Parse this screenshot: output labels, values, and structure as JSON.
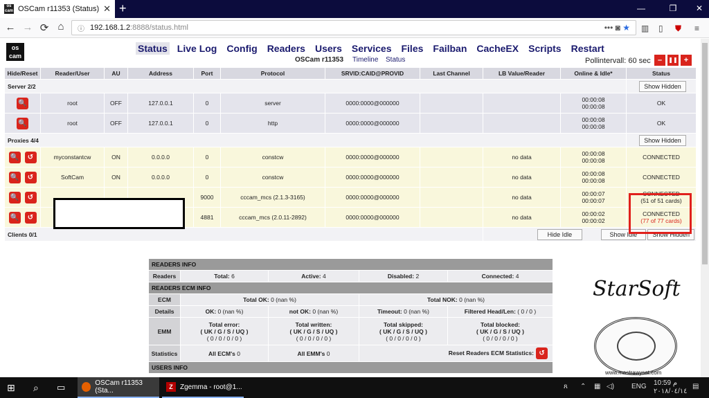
{
  "browser": {
    "tab_title": "OSCam r11353 (Status)",
    "new_tab": "+",
    "url_host": "192.168.1.2",
    "url_path": ":8888/status.html",
    "favicon": "os cam"
  },
  "nav": {
    "back": "←",
    "forward": "→",
    "reload": "⟳",
    "home": "⌂",
    "more": "•••",
    "menu": "≡"
  },
  "oscam": {
    "logo": "os cam",
    "menu": [
      "Status",
      "Live Log",
      "Config",
      "Readers",
      "Users",
      "Services",
      "Files",
      "Failban",
      "CacheEX",
      "Scripts",
      "Restart"
    ],
    "version": "OSCam r11353",
    "timeline": "Timeline",
    "status": "Status",
    "pollinterval": "Pollintervall: 60 sec",
    "btn_minus": "–",
    "btn_pause": "❚❚",
    "btn_plus": "+"
  },
  "table": {
    "headers": [
      "Hide/Reset",
      "Reader/User",
      "AU",
      "Address",
      "Port",
      "Protocol",
      "SRVID:CAID@PROVID",
      "Last Channel",
      "LB Value/Reader",
      "Online & Idle*",
      "Status"
    ],
    "server_label": "Server 2/2",
    "show_hidden": "Show Hidden",
    "servers": [
      {
        "user": "root",
        "au": "OFF",
        "addr": "127.0.0.1",
        "port": "0",
        "proto": "server",
        "srvid": "0000:0000@000000",
        "t1": "00:00:08",
        "t2": "00:00:08",
        "status": "OK"
      },
      {
        "user": "root",
        "au": "OFF",
        "addr": "127.0.0.1",
        "port": "0",
        "proto": "http",
        "srvid": "0000:0000@000000",
        "t1": "00:00:08",
        "t2": "00:00:08",
        "status": "OK"
      }
    ],
    "proxies_label": "Proxies 4/4",
    "proxies": [
      {
        "user": "myconstantcw",
        "au": "ON",
        "addr": "0.0.0.0",
        "port": "0",
        "proto": "constcw",
        "srvid": "0000:0000@000000",
        "lb": "no data",
        "t1": "00:00:08",
        "t2": "00:00:08",
        "status": "CONNECTED",
        "cards": ""
      },
      {
        "user": "SoftCam",
        "au": "ON",
        "addr": "0.0.0.0",
        "port": "0",
        "proto": "constcw",
        "srvid": "0000:0000@000000",
        "lb": "no data",
        "t1": "00:00:08",
        "t2": "00:00:08",
        "status": "CONNECTED",
        "cards": ""
      },
      {
        "user": "",
        "au": "",
        "addr": "",
        "port": "9000",
        "proto": "cccam_mcs (2.1.3-3165)",
        "srvid": "0000:0000@000000",
        "lb": "no data",
        "t1": "00:00:07",
        "t2": "00:00:07",
        "status": "CONNECTED",
        "cards": "(51 of 51 cards)"
      },
      {
        "user": "",
        "au": "",
        "addr": "",
        "port": "4881",
        "proto": "cccam_mcs (2.0.11-2892)",
        "srvid": "0000:0000@000000",
        "lb": "no data",
        "t1": "00:00:02",
        "t2": "00:00:02",
        "status": "CONNECTED",
        "cards": "(77 of 77 cards)"
      }
    ],
    "clients_label": "Clients 0/1",
    "hide_idle": "Hide Idle",
    "show_idle": "Show Idle"
  },
  "readers_info": {
    "title": "READERS INFO",
    "readers": "Readers",
    "total": "Total:",
    "total_v": "6",
    "active": "Active:",
    "active_v": "4",
    "disabled": "Disabled:",
    "disabled_v": "2",
    "connected": "Connected:",
    "connected_v": "4",
    "ecm_title": "READERS ECM INFO",
    "ecm": "ECM",
    "total_ok": "Total OK:",
    "total_ok_v": "0 (nan %)",
    "total_nok": "Total NOK:",
    "total_nok_v": "0 (nan %)",
    "details": "Details",
    "ok": "OK:",
    "ok_v": "0 (nan %)",
    "notok": "not OK:",
    "notok_v": "0 (nan %)",
    "timeout": "Timeout:",
    "timeout_v": "0 (nan %)",
    "filtered": "Filtered Head/Len:",
    "filtered_v": "( 0 / 0 )",
    "emm": "EMM",
    "emm_cols": [
      {
        "label": "Total error:"
      },
      {
        "label": "Total written:"
      },
      {
        "label": "Total skipped:"
      },
      {
        "label": "Total blocked:"
      }
    ],
    "emm_hdr": "( UK / G / S / UQ )",
    "emm_val": "( 0 / 0 / 0 / 0 )",
    "statistics": "Statistics",
    "all_ecm": "All ECM's",
    "all_ecm_v": "0",
    "all_emm": "All EMM's",
    "all_emm_v": "0",
    "reset": "Reset Readers ECM Statistics:",
    "users_title": "USERS INFO"
  },
  "watermark": {
    "text": "StarSoft",
    "seal": "www.mastrawysat.com"
  },
  "taskbar": {
    "app1": "OSCam r11353 (Sta...",
    "app2": "Zgemma - root@1...",
    "lang": "ENG",
    "time": "10:59 م",
    "date": "٢٠١٨/٠٤/١٤"
  }
}
